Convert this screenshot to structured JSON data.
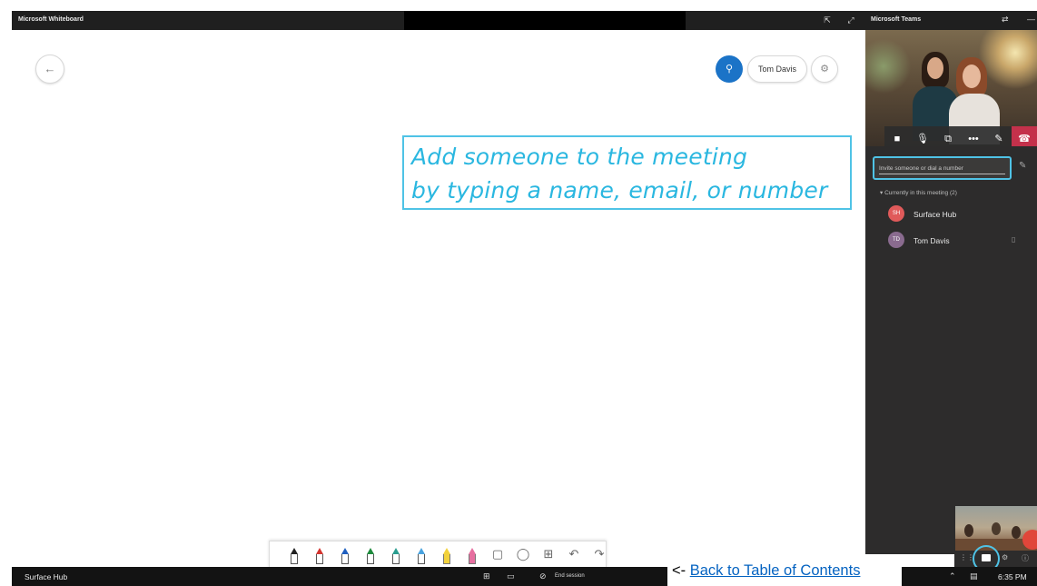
{
  "whiteboard": {
    "title": "Microsoft Whiteboard",
    "back_icon": "arrow-left-icon",
    "user_name": "Tom Davis",
    "avatar_icon": "person-icon",
    "settings_icon": "gear-icon"
  },
  "callout": {
    "line1": "Add someone to the meeting",
    "line2": "by typing a name, email, or number",
    "color": "#2ab7e0"
  },
  "toolbar": {
    "tools": [
      {
        "name": "pen-black",
        "color": "#222222"
      },
      {
        "name": "pen-red",
        "color": "#d3342f"
      },
      {
        "name": "pen-blue",
        "color": "#1f5fbf"
      },
      {
        "name": "pen-green",
        "color": "#1e8a3c"
      },
      {
        "name": "pen-teal",
        "color": "#2a9d8f"
      },
      {
        "name": "pen-lightblue",
        "color": "#4aa3df"
      },
      {
        "name": "highlighter-yellow",
        "color": "#f2d23c"
      },
      {
        "name": "highlighter-pink",
        "color": "#e76fa0"
      }
    ],
    "icons": [
      "eraser-icon",
      "lasso-icon",
      "insert-icon",
      "undo-icon",
      "redo-icon"
    ]
  },
  "teams": {
    "title": "Microsoft Teams",
    "invite_placeholder": "Invite someone or dial a number",
    "section_label": "Currently in this meeting (2)",
    "participants": [
      {
        "name": "Surface Hub",
        "initials": "SH",
        "color": "#e05a5a"
      },
      {
        "name": "Tom Davis",
        "initials": "TD",
        "color": "#8a6b8f"
      }
    ],
    "controls": [
      "video-icon",
      "mic-icon",
      "share-screen-icon",
      "more-icon",
      "whiteboard-icon",
      "hang-up-icon"
    ]
  },
  "taskbar": {
    "host": "Surface Hub",
    "end_session": "End session",
    "time": "6:35 PM"
  },
  "footer": {
    "prefix": "<- ",
    "link_text": "Back to Table of Contents"
  }
}
